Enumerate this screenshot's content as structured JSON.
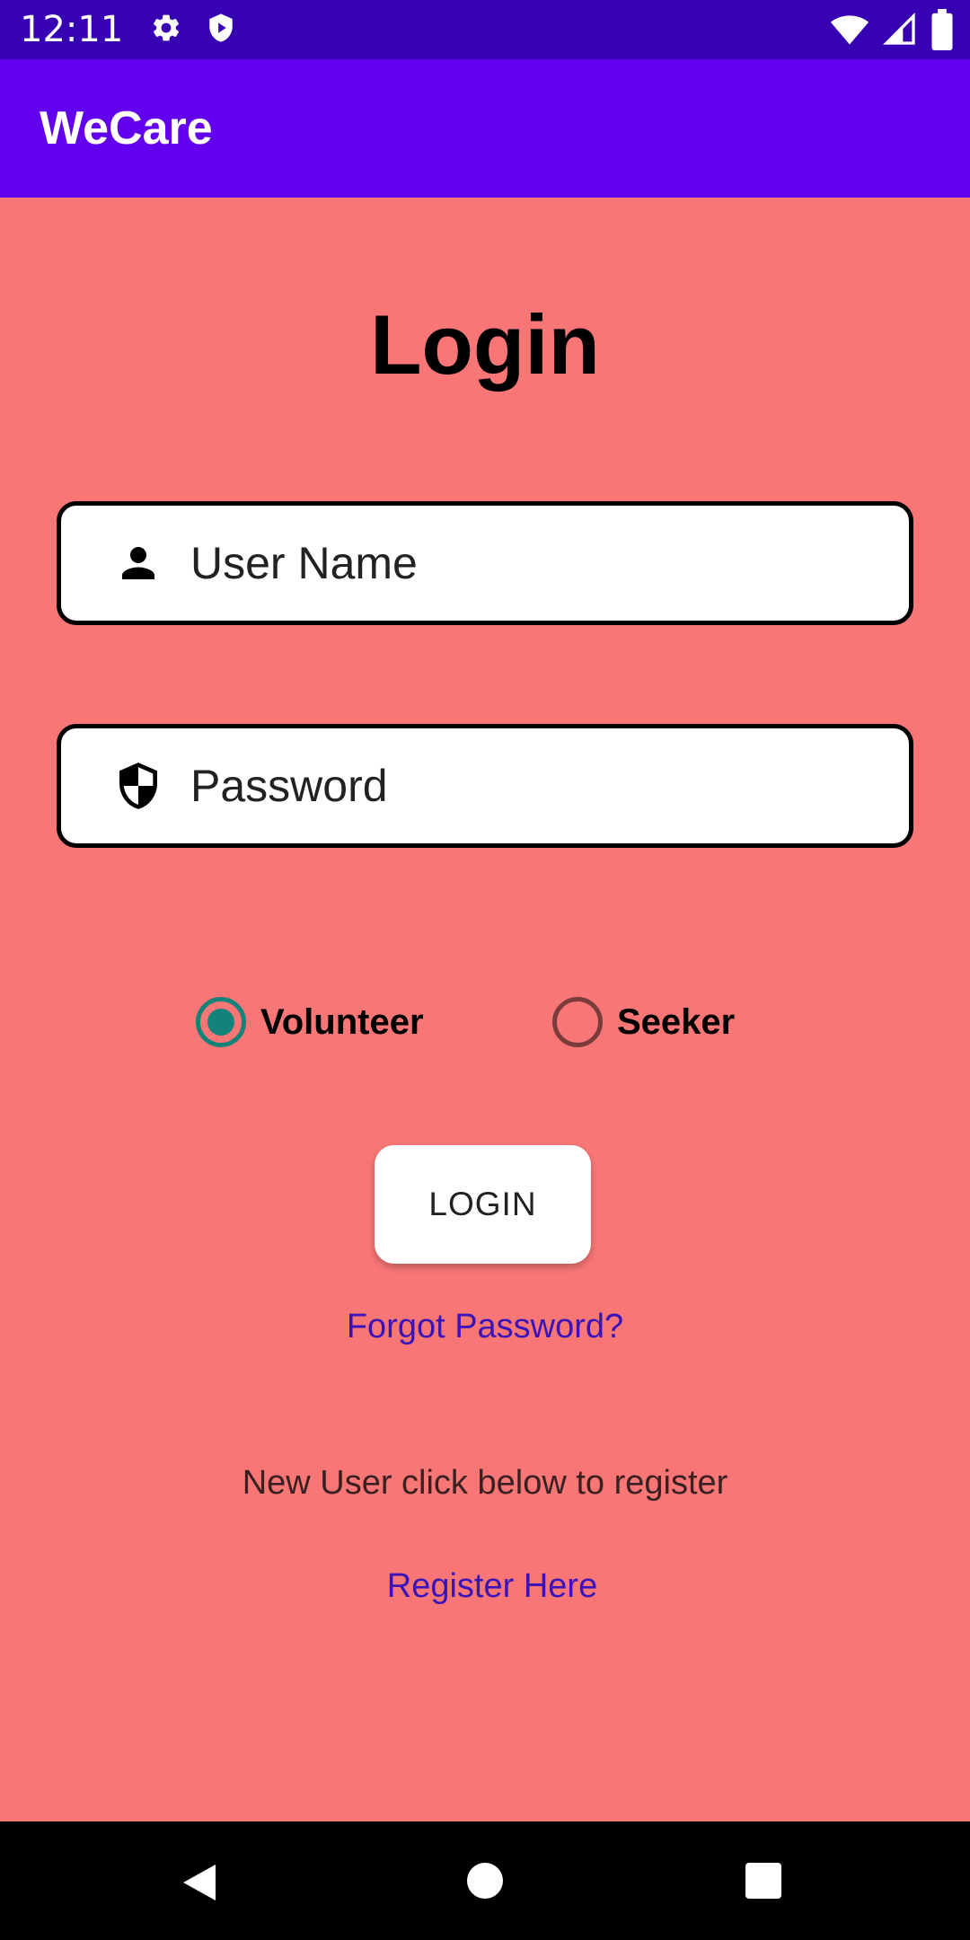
{
  "status_bar": {
    "time": "12:11",
    "icons": [
      "settings-icon",
      "shield-play-icon",
      "wifi-icon",
      "signal-icon",
      "battery-icon"
    ]
  },
  "app_bar": {
    "title": "WeCare",
    "color": "#6200EE"
  },
  "login": {
    "title": "Login",
    "username_placeholder": "User Name",
    "password_placeholder": "Password",
    "role_options": [
      {
        "label": "Volunteer",
        "selected": true
      },
      {
        "label": "Seeker",
        "selected": false
      }
    ],
    "login_button": "LOGIN",
    "forgot_password": "Forgot Password?",
    "new_user_text": "New User click below to register",
    "register_link": "Register Here"
  },
  "colors": {
    "background": "#F87676",
    "accent_radio": "#13837A",
    "link": "#3A14B8",
    "status_bar": "#3700B3"
  },
  "nav_bar": {
    "buttons": [
      "back-icon",
      "home-icon",
      "recents-icon"
    ]
  }
}
